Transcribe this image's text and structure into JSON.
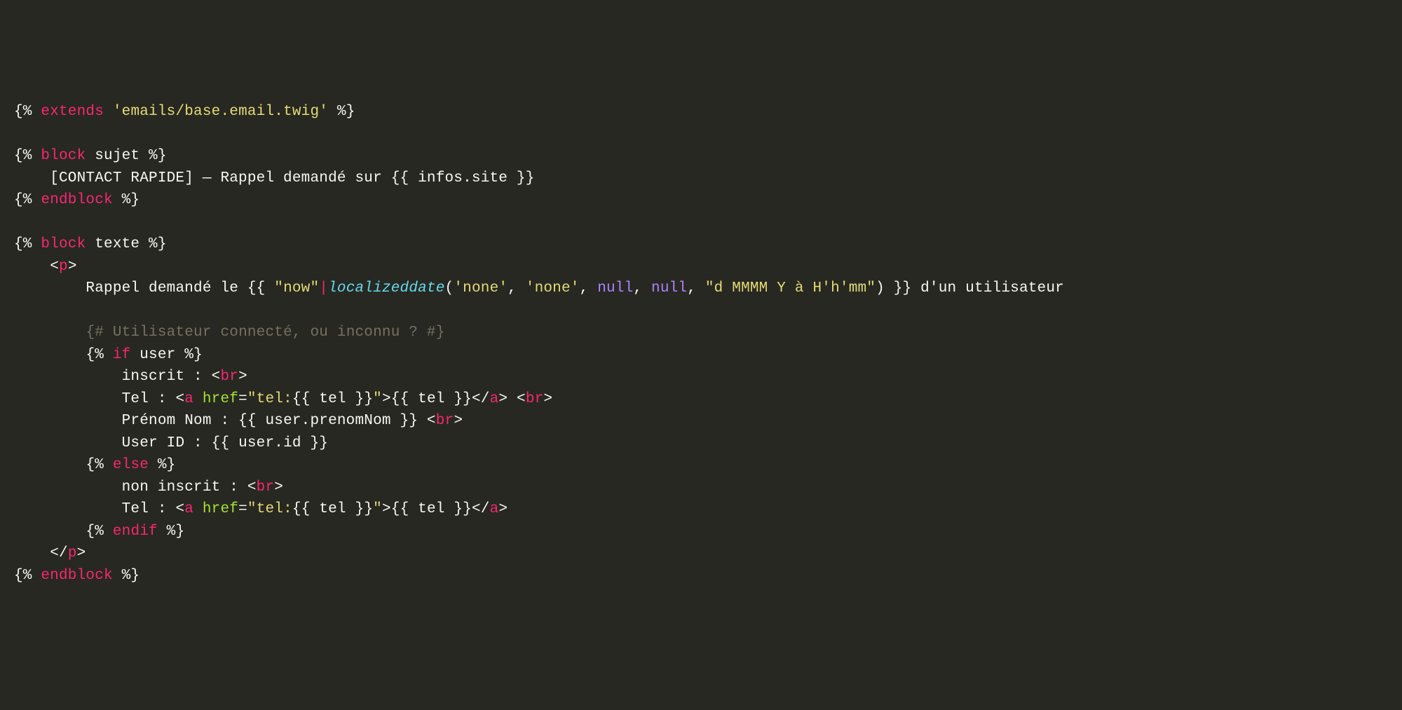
{
  "lines": [
    [
      {
        "cls": "delim",
        "t": "{% "
      },
      {
        "cls": "keyword",
        "t": "extends"
      },
      {
        "cls": "delim",
        "t": " "
      },
      {
        "cls": "string",
        "t": "'emails/base.email.twig'"
      },
      {
        "cls": "delim",
        "t": " %}"
      }
    ],
    [],
    [
      {
        "cls": "delim",
        "t": "{% "
      },
      {
        "cls": "keyword",
        "t": "block"
      },
      {
        "cls": "text",
        "t": " sujet "
      },
      {
        "cls": "delim",
        "t": "%}"
      }
    ],
    [
      {
        "cls": "text",
        "t": "    [CONTACT RAPIDE] — Rappel demandé sur "
      },
      {
        "cls": "delim",
        "t": "{{ "
      },
      {
        "cls": "text",
        "t": "infos.site"
      },
      {
        "cls": "delim",
        "t": " }}"
      }
    ],
    [
      {
        "cls": "delim",
        "t": "{% "
      },
      {
        "cls": "keyword",
        "t": "endblock"
      },
      {
        "cls": "delim",
        "t": " %}"
      }
    ],
    [],
    [
      {
        "cls": "delim",
        "t": "{% "
      },
      {
        "cls": "keyword",
        "t": "block"
      },
      {
        "cls": "text",
        "t": " texte "
      },
      {
        "cls": "delim",
        "t": "%}"
      }
    ],
    [
      {
        "cls": "guide",
        "t": "    "
      },
      {
        "cls": "text",
        "t": "<"
      },
      {
        "cls": "tag",
        "t": "p"
      },
      {
        "cls": "text",
        "t": ">"
      }
    ],
    [
      {
        "cls": "guide",
        "t": "    "
      },
      {
        "cls": "text",
        "t": "    Rappel demandé le "
      },
      {
        "cls": "delim",
        "t": "{{ "
      },
      {
        "cls": "string",
        "t": "\"now\""
      },
      {
        "cls": "pipe",
        "t": "|"
      },
      {
        "cls": "func",
        "t": "localizeddate"
      },
      {
        "cls": "text",
        "t": "("
      },
      {
        "cls": "string",
        "t": "'none'"
      },
      {
        "cls": "text",
        "t": ", "
      },
      {
        "cls": "string",
        "t": "'none'"
      },
      {
        "cls": "text",
        "t": ", "
      },
      {
        "cls": "null",
        "t": "null"
      },
      {
        "cls": "text",
        "t": ", "
      },
      {
        "cls": "null",
        "t": "null"
      },
      {
        "cls": "text",
        "t": ", "
      },
      {
        "cls": "string",
        "t": "\"d MMMM Y à H'h'mm\""
      },
      {
        "cls": "text",
        "t": ")"
      },
      {
        "cls": "delim",
        "t": " }}"
      },
      {
        "cls": "text",
        "t": " d'un utilisateur"
      }
    ],
    [],
    [
      {
        "cls": "guide",
        "t": "    "
      },
      {
        "cls": "text",
        "t": "    "
      },
      {
        "cls": "comment",
        "t": "{# Utilisateur connecté, ou inconnu ? #}"
      }
    ],
    [
      {
        "cls": "guide",
        "t": "    "
      },
      {
        "cls": "text",
        "t": "    "
      },
      {
        "cls": "delim",
        "t": "{% "
      },
      {
        "cls": "keyword",
        "t": "if"
      },
      {
        "cls": "text",
        "t": " user "
      },
      {
        "cls": "delim",
        "t": "%}"
      }
    ],
    [
      {
        "cls": "guide",
        "t": "    "
      },
      {
        "cls": "text",
        "t": "        inscrit : <"
      },
      {
        "cls": "tag",
        "t": "br"
      },
      {
        "cls": "text",
        "t": ">"
      }
    ],
    [
      {
        "cls": "guide",
        "t": "    "
      },
      {
        "cls": "text",
        "t": "        Tel : <"
      },
      {
        "cls": "tag",
        "t": "a"
      },
      {
        "cls": "text",
        "t": " "
      },
      {
        "cls": "attr",
        "t": "href"
      },
      {
        "cls": "text",
        "t": "="
      },
      {
        "cls": "string",
        "t": "\"tel:"
      },
      {
        "cls": "delim",
        "t": "{{ "
      },
      {
        "cls": "text",
        "t": "tel"
      },
      {
        "cls": "delim",
        "t": " }}"
      },
      {
        "cls": "string",
        "t": "\""
      },
      {
        "cls": "text",
        "t": ">"
      },
      {
        "cls": "delim",
        "t": "{{ "
      },
      {
        "cls": "text",
        "t": "tel"
      },
      {
        "cls": "delim",
        "t": " }}"
      },
      {
        "cls": "text",
        "t": "</"
      },
      {
        "cls": "tag",
        "t": "a"
      },
      {
        "cls": "text",
        "t": "> <"
      },
      {
        "cls": "tag",
        "t": "br"
      },
      {
        "cls": "text",
        "t": ">"
      }
    ],
    [
      {
        "cls": "guide",
        "t": "    "
      },
      {
        "cls": "text",
        "t": "        Prénom Nom : "
      },
      {
        "cls": "delim",
        "t": "{{ "
      },
      {
        "cls": "text",
        "t": "user.prenomNom"
      },
      {
        "cls": "delim",
        "t": " }}"
      },
      {
        "cls": "text",
        "t": " <"
      },
      {
        "cls": "tag",
        "t": "br"
      },
      {
        "cls": "text",
        "t": ">"
      }
    ],
    [
      {
        "cls": "guide",
        "t": "    "
      },
      {
        "cls": "text",
        "t": "        User ID : "
      },
      {
        "cls": "delim",
        "t": "{{ "
      },
      {
        "cls": "text",
        "t": "user.id"
      },
      {
        "cls": "delim",
        "t": " }}"
      }
    ],
    [
      {
        "cls": "guide",
        "t": "    "
      },
      {
        "cls": "text",
        "t": "    "
      },
      {
        "cls": "delim",
        "t": "{% "
      },
      {
        "cls": "keyword",
        "t": "else"
      },
      {
        "cls": "delim",
        "t": " %}"
      }
    ],
    [
      {
        "cls": "guide",
        "t": "    "
      },
      {
        "cls": "text",
        "t": "        non inscrit : <"
      },
      {
        "cls": "tag",
        "t": "br"
      },
      {
        "cls": "text",
        "t": ">"
      }
    ],
    [
      {
        "cls": "guide",
        "t": "    "
      },
      {
        "cls": "text",
        "t": "        Tel : <"
      },
      {
        "cls": "tag",
        "t": "a"
      },
      {
        "cls": "text",
        "t": " "
      },
      {
        "cls": "attr",
        "t": "href"
      },
      {
        "cls": "text",
        "t": "="
      },
      {
        "cls": "string",
        "t": "\"tel:"
      },
      {
        "cls": "delim",
        "t": "{{ "
      },
      {
        "cls": "text",
        "t": "tel"
      },
      {
        "cls": "delim",
        "t": " }}"
      },
      {
        "cls": "string",
        "t": "\""
      },
      {
        "cls": "text",
        "t": ">"
      },
      {
        "cls": "delim",
        "t": "{{ "
      },
      {
        "cls": "text",
        "t": "tel"
      },
      {
        "cls": "delim",
        "t": " }}"
      },
      {
        "cls": "text",
        "t": "</"
      },
      {
        "cls": "tag",
        "t": "a"
      },
      {
        "cls": "text",
        "t": ">"
      }
    ],
    [
      {
        "cls": "guide",
        "t": "    "
      },
      {
        "cls": "text",
        "t": "    "
      },
      {
        "cls": "delim",
        "t": "{% "
      },
      {
        "cls": "keyword",
        "t": "endif"
      },
      {
        "cls": "delim",
        "t": " %}"
      }
    ],
    [
      {
        "cls": "guide",
        "t": "    "
      },
      {
        "cls": "text",
        "t": "</"
      },
      {
        "cls": "tag",
        "t": "p"
      },
      {
        "cls": "text",
        "t": ">"
      }
    ],
    [
      {
        "cls": "delim",
        "t": "{% "
      },
      {
        "cls": "keyword",
        "t": "endblock"
      },
      {
        "cls": "delim",
        "t": " %}"
      }
    ]
  ]
}
